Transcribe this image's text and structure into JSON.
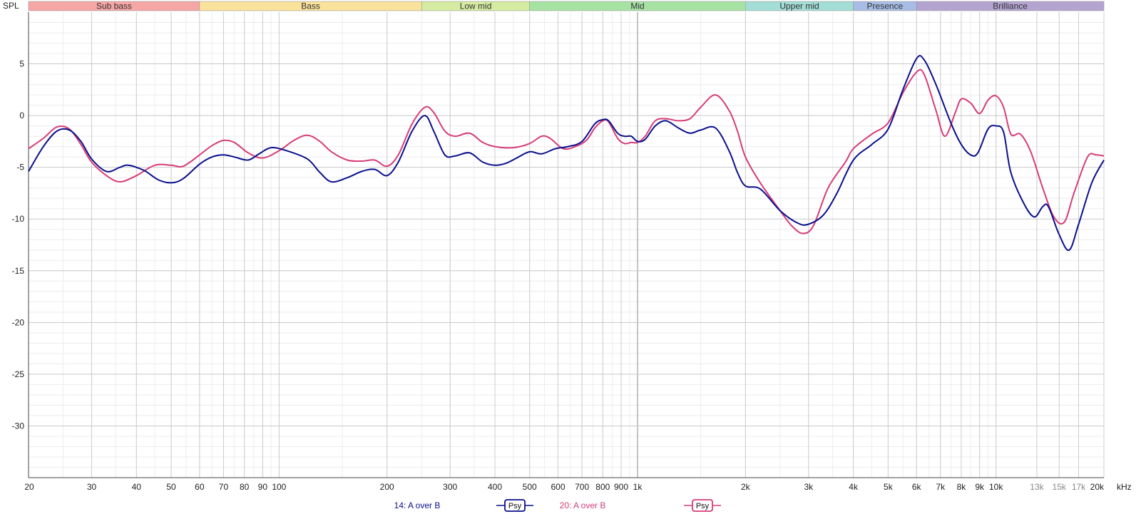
{
  "chart_data": {
    "type": "line",
    "ylabel": "SPL",
    "x_unit_label": "kHz",
    "x_scale": "log",
    "xlim": [
      20,
      20000
    ],
    "ylim": [
      -35,
      10
    ],
    "grid": true,
    "legend_position": "bottom",
    "bands": [
      {
        "name": "Sub bass",
        "from": 20,
        "to": 60,
        "color": "#f7a6a6"
      },
      {
        "name": "Bass",
        "from": 60,
        "to": 250,
        "color": "#fbe29a"
      },
      {
        "name": "Low mid",
        "from": 250,
        "to": 500,
        "color": "#d6eba2"
      },
      {
        "name": "Mid",
        "from": 500,
        "to": 2000,
        "color": "#a6e3a3"
      },
      {
        "name": "Upper mid",
        "from": 2000,
        "to": 4000,
        "color": "#a3ded6"
      },
      {
        "name": "Presence",
        "from": 4000,
        "to": 6000,
        "color": "#a8bde6"
      },
      {
        "name": "Brilliance",
        "from": 6000,
        "to": 20000,
        "color": "#b3a3d1"
      }
    ],
    "x_ticks": [
      {
        "v": 20,
        "label": "20",
        "minor": false
      },
      {
        "v": 30,
        "label": "30",
        "minor": false
      },
      {
        "v": 40,
        "label": "40",
        "minor": false
      },
      {
        "v": 50,
        "label": "50",
        "minor": false
      },
      {
        "v": 60,
        "label": "60",
        "minor": false
      },
      {
        "v": 70,
        "label": "70",
        "minor": false
      },
      {
        "v": 80,
        "label": "80",
        "minor": false
      },
      {
        "v": 90,
        "label": "90",
        "minor": false
      },
      {
        "v": 100,
        "label": "100",
        "minor": false
      },
      {
        "v": 200,
        "label": "200",
        "minor": false
      },
      {
        "v": 300,
        "label": "300",
        "minor": false
      },
      {
        "v": 400,
        "label": "400",
        "minor": false
      },
      {
        "v": 500,
        "label": "500",
        "minor": false
      },
      {
        "v": 600,
        "label": "600",
        "minor": false
      },
      {
        "v": 700,
        "label": "700",
        "minor": false
      },
      {
        "v": 800,
        "label": "800",
        "minor": false
      },
      {
        "v": 900,
        "label": "900",
        "minor": false
      },
      {
        "v": 1000,
        "label": "1k",
        "minor": false
      },
      {
        "v": 2000,
        "label": "2k",
        "minor": false
      },
      {
        "v": 3000,
        "label": "3k",
        "minor": false
      },
      {
        "v": 4000,
        "label": "4k",
        "minor": false
      },
      {
        "v": 5000,
        "label": "5k",
        "minor": false
      },
      {
        "v": 6000,
        "label": "6k",
        "minor": false
      },
      {
        "v": 7000,
        "label": "7k",
        "minor": false
      },
      {
        "v": 8000,
        "label": "8k",
        "minor": false
      },
      {
        "v": 9000,
        "label": "9k",
        "minor": false
      },
      {
        "v": 10000,
        "label": "10k",
        "minor": false
      },
      {
        "v": 13000,
        "label": "13k",
        "minor": true
      },
      {
        "v": 15000,
        "label": "15k",
        "minor": true
      },
      {
        "v": 17000,
        "label": "17k",
        "minor": true
      },
      {
        "v": 20000,
        "label": "20k",
        "minor": false
      }
    ],
    "y_ticks": [
      5,
      0,
      -5,
      -10,
      -15,
      -20,
      -25,
      -30
    ],
    "series": [
      {
        "name": "14: A over B",
        "color": "#0a0f8c",
        "badge": "Psy",
        "points": [
          [
            20,
            -5.4
          ],
          [
            22,
            -3.0
          ],
          [
            24,
            -1.5
          ],
          [
            26,
            -1.4
          ],
          [
            28,
            -2.5
          ],
          [
            30,
            -4.2
          ],
          [
            33,
            -5.4
          ],
          [
            36,
            -5.0
          ],
          [
            38,
            -4.8
          ],
          [
            42,
            -5.3
          ],
          [
            46,
            -6.2
          ],
          [
            50,
            -6.5
          ],
          [
            54,
            -6.1
          ],
          [
            60,
            -4.7
          ],
          [
            65,
            -4.0
          ],
          [
            70,
            -3.8
          ],
          [
            75,
            -4.0
          ],
          [
            82,
            -4.3
          ],
          [
            88,
            -3.7
          ],
          [
            95,
            -3.1
          ],
          [
            105,
            -3.4
          ],
          [
            120,
            -4.2
          ],
          [
            130,
            -5.5
          ],
          [
            140,
            -6.4
          ],
          [
            155,
            -6.0
          ],
          [
            170,
            -5.4
          ],
          [
            185,
            -5.2
          ],
          [
            200,
            -5.8
          ],
          [
            215,
            -4.5
          ],
          [
            235,
            -1.5
          ],
          [
            255,
            0.0
          ],
          [
            270,
            -1.5
          ],
          [
            290,
            -3.8
          ],
          [
            310,
            -3.9
          ],
          [
            340,
            -3.6
          ],
          [
            370,
            -4.5
          ],
          [
            400,
            -4.8
          ],
          [
            430,
            -4.6
          ],
          [
            460,
            -4.1
          ],
          [
            500,
            -3.5
          ],
          [
            540,
            -3.7
          ],
          [
            590,
            -3.2
          ],
          [
            640,
            -3.0
          ],
          [
            700,
            -2.5
          ],
          [
            760,
            -0.8
          ],
          [
            800,
            -0.4
          ],
          [
            830,
            -0.5
          ],
          [
            880,
            -1.7
          ],
          [
            920,
            -2.0
          ],
          [
            960,
            -2.0
          ],
          [
            1000,
            -2.5
          ],
          [
            1050,
            -2.3
          ],
          [
            1120,
            -1.0
          ],
          [
            1200,
            -0.5
          ],
          [
            1300,
            -1.2
          ],
          [
            1400,
            -1.7
          ],
          [
            1500,
            -1.4
          ],
          [
            1650,
            -1.2
          ],
          [
            1800,
            -3.4
          ],
          [
            1900,
            -5.5
          ],
          [
            2000,
            -6.8
          ],
          [
            2200,
            -7.1
          ],
          [
            2500,
            -9.2
          ],
          [
            2800,
            -10.4
          ],
          [
            3000,
            -10.5
          ],
          [
            3300,
            -9.6
          ],
          [
            3600,
            -7.5
          ],
          [
            4000,
            -4.3
          ],
          [
            4500,
            -2.8
          ],
          [
            5000,
            -1.3
          ],
          [
            5500,
            2.5
          ],
          [
            6000,
            5.5
          ],
          [
            6300,
            5.4
          ],
          [
            6800,
            3.0
          ],
          [
            7500,
            -0.8
          ],
          [
            8000,
            -2.8
          ],
          [
            8500,
            -3.8
          ],
          [
            8900,
            -3.6
          ],
          [
            9500,
            -1.3
          ],
          [
            10000,
            -1.0
          ],
          [
            10500,
            -1.6
          ],
          [
            11000,
            -5.5
          ],
          [
            12000,
            -8.6
          ],
          [
            12800,
            -9.8
          ],
          [
            13500,
            -8.8
          ],
          [
            14000,
            -8.8
          ],
          [
            15000,
            -11.5
          ],
          [
            16000,
            -13.0
          ],
          [
            17000,
            -10.5
          ],
          [
            18500,
            -6.5
          ],
          [
            20000,
            -4.3
          ]
        ]
      },
      {
        "name": "20: A over B",
        "color": "#d63c78",
        "badge": "Psy",
        "points": [
          [
            20,
            -3.2
          ],
          [
            22,
            -2.2
          ],
          [
            24,
            -1.1
          ],
          [
            26,
            -1.3
          ],
          [
            28,
            -2.8
          ],
          [
            30,
            -4.5
          ],
          [
            33,
            -5.8
          ],
          [
            36,
            -6.4
          ],
          [
            40,
            -5.8
          ],
          [
            45,
            -4.8
          ],
          [
            50,
            -4.8
          ],
          [
            54,
            -4.9
          ],
          [
            60,
            -3.8
          ],
          [
            65,
            -2.9
          ],
          [
            70,
            -2.4
          ],
          [
            75,
            -2.6
          ],
          [
            82,
            -3.6
          ],
          [
            90,
            -4.1
          ],
          [
            100,
            -3.4
          ],
          [
            110,
            -2.4
          ],
          [
            120,
            -1.9
          ],
          [
            130,
            -2.5
          ],
          [
            140,
            -3.5
          ],
          [
            155,
            -4.3
          ],
          [
            170,
            -4.4
          ],
          [
            185,
            -4.3
          ],
          [
            200,
            -4.9
          ],
          [
            215,
            -3.8
          ],
          [
            235,
            -0.8
          ],
          [
            255,
            0.8
          ],
          [
            270,
            0.3
          ],
          [
            290,
            -1.5
          ],
          [
            310,
            -2.0
          ],
          [
            340,
            -1.7
          ],
          [
            370,
            -2.6
          ],
          [
            400,
            -3.0
          ],
          [
            450,
            -3.1
          ],
          [
            500,
            -2.7
          ],
          [
            540,
            -2.0
          ],
          [
            570,
            -2.2
          ],
          [
            620,
            -3.2
          ],
          [
            670,
            -3.0
          ],
          [
            720,
            -2.4
          ],
          [
            760,
            -1.2
          ],
          [
            800,
            -0.5
          ],
          [
            830,
            -0.6
          ],
          [
            880,
            -2.2
          ],
          [
            920,
            -2.7
          ],
          [
            960,
            -2.6
          ],
          [
            1000,
            -2.6
          ],
          [
            1050,
            -2.0
          ],
          [
            1120,
            -0.5
          ],
          [
            1200,
            -0.3
          ],
          [
            1300,
            -0.5
          ],
          [
            1400,
            -0.3
          ],
          [
            1500,
            0.8
          ],
          [
            1650,
            2.0
          ],
          [
            1800,
            0.5
          ],
          [
            1900,
            -1.5
          ],
          [
            2000,
            -4.0
          ],
          [
            2200,
            -6.5
          ],
          [
            2500,
            -9.2
          ],
          [
            2700,
            -10.7
          ],
          [
            2900,
            -11.4
          ],
          [
            3100,
            -10.6
          ],
          [
            3400,
            -7.0
          ],
          [
            3800,
            -4.5
          ],
          [
            4000,
            -3.2
          ],
          [
            4500,
            -1.8
          ],
          [
            5000,
            -0.7
          ],
          [
            5500,
            2.2
          ],
          [
            6000,
            4.2
          ],
          [
            6300,
            4.0
          ],
          [
            6800,
            0.5
          ],
          [
            7200,
            -2.0
          ],
          [
            7700,
            0.3
          ],
          [
            8000,
            1.6
          ],
          [
            8500,
            1.2
          ],
          [
            9000,
            0.2
          ],
          [
            9500,
            1.5
          ],
          [
            10000,
            1.9
          ],
          [
            10500,
            0.8
          ],
          [
            11000,
            -1.8
          ],
          [
            11700,
            -1.8
          ],
          [
            12500,
            -3.5
          ],
          [
            13500,
            -7.0
          ],
          [
            14500,
            -9.8
          ],
          [
            15500,
            -10.3
          ],
          [
            16500,
            -7.5
          ],
          [
            18000,
            -4.0
          ],
          [
            19000,
            -3.8
          ],
          [
            20000,
            -3.9
          ]
        ]
      }
    ]
  }
}
